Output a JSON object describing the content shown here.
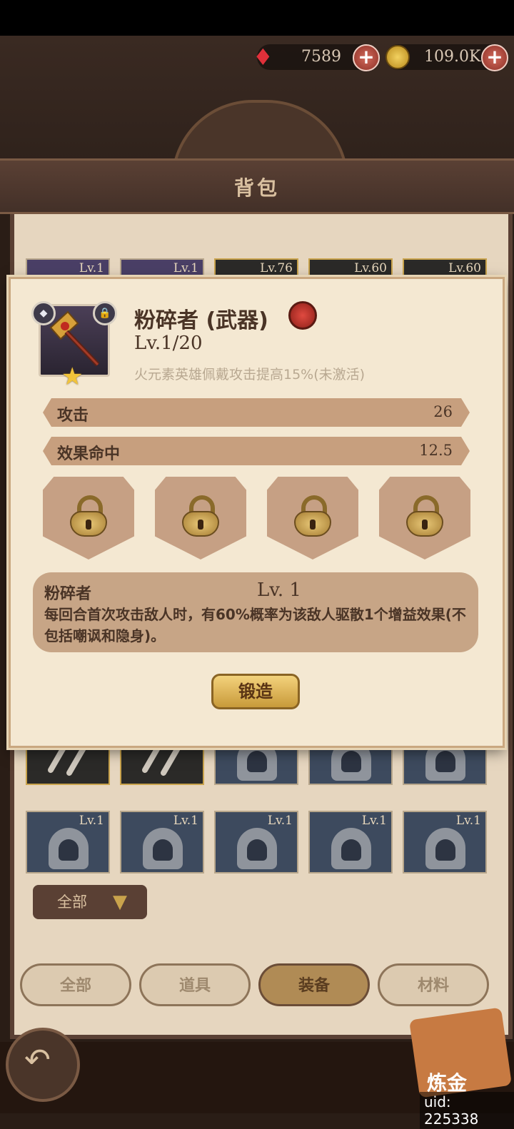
{
  "currency": {
    "gems": "7589",
    "gold": "109.0K",
    "plus_label": "+"
  },
  "window_title": "背包",
  "grid": {
    "top_row_levels": [
      "Lv.1",
      "Lv.1",
      "Lv.76",
      "Lv.60",
      "Lv.60"
    ],
    "bottom_row_levels": [
      "Lv.1",
      "Lv.1",
      "Lv.1",
      "Lv.1",
      "Lv.1"
    ]
  },
  "filter": {
    "selected": "全部",
    "arrow": "▼"
  },
  "tabs": [
    {
      "label": "全部"
    },
    {
      "label": "道具"
    },
    {
      "label": "装备"
    },
    {
      "label": "材料"
    }
  ],
  "alchemy_label": "炼金",
  "uid_text": "uid: 225338",
  "dialog": {
    "item": {
      "name": "粉碎者 (武器)",
      "level": "Lv.1/20",
      "bonus_desc": "火元素英雄佩戴攻击提高15%(未激活)",
      "lock_icon": "🔒",
      "star": "★"
    },
    "stats": [
      {
        "label": "攻击",
        "value": "26"
      },
      {
        "label": "效果命中",
        "value": "12.5"
      }
    ],
    "skill": {
      "name": "粉碎者",
      "level": "Lv. 1",
      "desc": "每回合首次攻击敌人时，有60%概率为该敌人驱散1个增益效果(不包括嘲讽和隐身)。"
    },
    "forge_label": "锻造"
  },
  "colors": {
    "parchment": "#f4e8d2",
    "stat_bar": "#c79f7e",
    "accent_gold": "#c89a3a",
    "dark_brown": "#4a3426"
  }
}
